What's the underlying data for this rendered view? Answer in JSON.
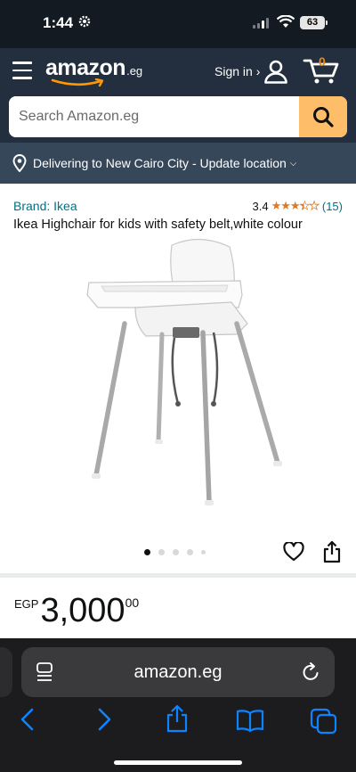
{
  "status_bar": {
    "time": "1:44",
    "battery": "63"
  },
  "header": {
    "logo_main": "amazon",
    "logo_tld": ".eg",
    "signin_label": "Sign in ›",
    "cart_count": "0"
  },
  "search": {
    "placeholder": "Search Amazon.eg"
  },
  "delivery": {
    "text": "Delivering to New Cairo City - Update location"
  },
  "product": {
    "brand": "Brand: Ikea",
    "rating": "3.4",
    "rating_count": "(15)",
    "title": "Ikea Highchair for kids with safety belt,white colour",
    "price_currency": "EGP",
    "price_whole": "3,000",
    "price_fraction": "00",
    "image_count": 5,
    "active_image": 1
  },
  "safari": {
    "url": "amazon.eg"
  },
  "colors": {
    "header_bg": "#232f3e",
    "delivery_bg": "#37475a",
    "search_btn": "#febd69",
    "link": "#007185",
    "star": "#de7921",
    "cart_count": "#f08804"
  },
  "icons": [
    "hamburger-icon",
    "user-icon",
    "cart-icon",
    "search-icon",
    "location-pin-icon",
    "heart-icon",
    "share-icon",
    "reader-icon",
    "reload-icon",
    "back-icon",
    "forward-icon",
    "share-sheet-icon",
    "bookmarks-icon",
    "tabs-icon"
  ]
}
